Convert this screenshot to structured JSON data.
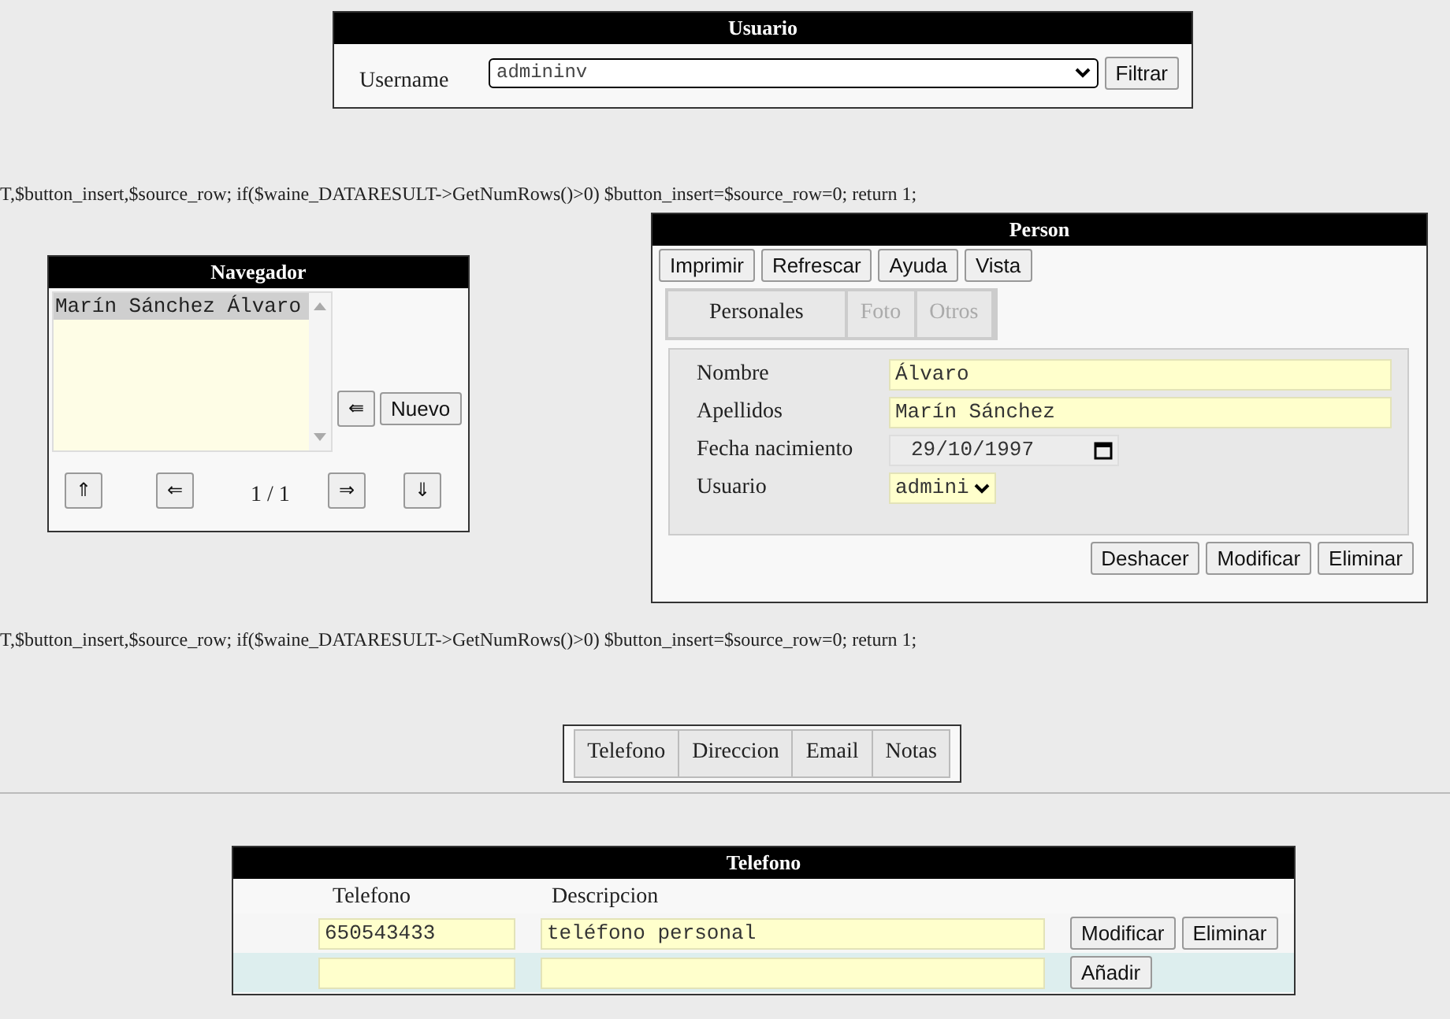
{
  "usuario_panel": {
    "title": "Usuario",
    "label": "Username",
    "select_value": "admininv",
    "button": "Filtrar"
  },
  "code_lines": [
    "T,$button_insert,$source_row; if($waine_DATARESULT->GetNumRows()>0) $button_insert=$source_row=0; return 1;",
    "T,$button_insert,$source_row; if($waine_DATARESULT->GetNumRows()>0) $button_insert=$source_row=0; return 1;"
  ],
  "navegador": {
    "title": "Navegador",
    "items": [
      {
        "label": "Marín Sánchez Álvaro",
        "selected": true
      }
    ],
    "side_buttons": [
      "⇚",
      "Nuevo"
    ],
    "nav_buttons": [
      "⇑",
      "⇐",
      "⇒",
      "⇓"
    ],
    "page": "1 / 1"
  },
  "person": {
    "title": "Person",
    "toolbar": [
      "Imprimir",
      "Refrescar",
      "Ayuda",
      "Vista"
    ],
    "tabs": [
      {
        "label": "Personales",
        "disabled": false
      },
      {
        "label": "Foto",
        "disabled": true
      },
      {
        "label": "Otros",
        "disabled": true
      }
    ],
    "fields": [
      {
        "label": "Nombre",
        "kind": "text",
        "value": "Álvaro"
      },
      {
        "label": "Apellidos",
        "kind": "text",
        "value": "Marín Sánchez"
      },
      {
        "label": "Fecha nacimiento",
        "kind": "date",
        "value": "29/10/1997"
      },
      {
        "label": "Usuario",
        "kind": "select",
        "value": "admini"
      }
    ],
    "actions": [
      "Deshacer",
      "Modificar",
      "Eliminar"
    ]
  },
  "section_tabs": [
    "Telefono",
    "Direccion",
    "Email",
    "Notas"
  ],
  "telefono": {
    "title": "Telefono",
    "columns": [
      "Telefono",
      "Descripcion"
    ],
    "rows": [
      {
        "kind": "record",
        "telefono": "650543433",
        "descripcion": "teléfono personal",
        "buttons": [
          "Modificar",
          "Eliminar"
        ]
      },
      {
        "kind": "new",
        "buttons": [
          "Añadir"
        ]
      }
    ]
  }
}
